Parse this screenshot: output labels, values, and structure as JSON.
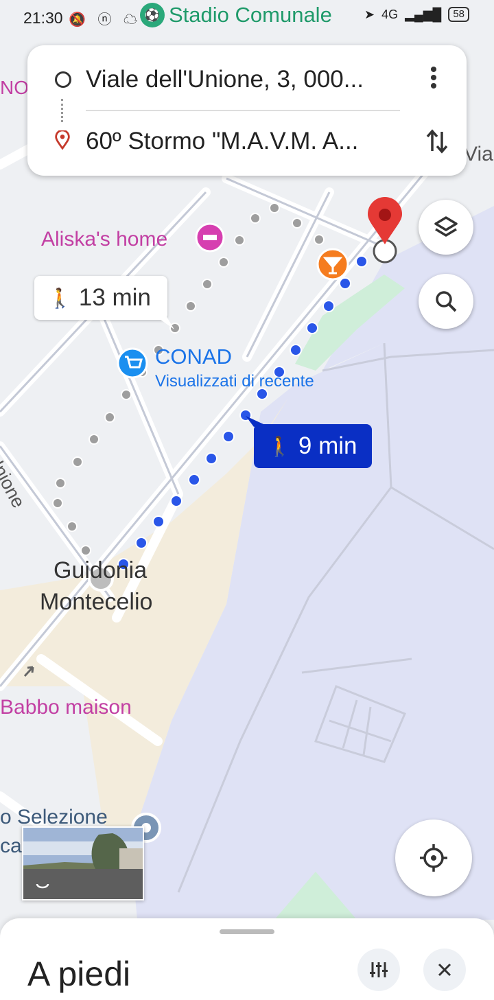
{
  "status_bar": {
    "time": "21:30",
    "left_icons": "🔕 ⓝ ☁ ▶",
    "network": "4G",
    "battery": "58"
  },
  "map_labels": {
    "stadio": "Stadio Comunale",
    "no_label": "NO",
    "via_label": "Via",
    "aliska": "Aliska's home",
    "conad": "CONAD",
    "conad_sub": "Visualizzati di recente",
    "unione_road": "ll'Unione",
    "guidonia_line1": "Guidonia",
    "guidonia_line2": "Montecelio",
    "babbo": "Babbo maison",
    "selezione": "o Selezione",
    "ca": "ca"
  },
  "route": {
    "origin": "Viale dell'Unione, 3, 000...",
    "destination": "60º Stormo \"M.A.V.M. A..."
  },
  "bubbles": {
    "alt_time": "13 min",
    "main_time": "9 min"
  },
  "sheet": {
    "title": "A piedi"
  },
  "icons": {
    "walk": "🚶",
    "more": "more-vert-icon",
    "swap": "swap-vert-icon",
    "layers": "layers-icon",
    "search": "search-icon",
    "location": "my-location-icon",
    "filter": "tune-icon",
    "close": "close-icon"
  },
  "colors": {
    "route_blue": "#2a56e8",
    "alt_route_gray": "#9e9e9e",
    "dest_pin": "#e53935",
    "bubble_blue": "#0a2fc4"
  }
}
